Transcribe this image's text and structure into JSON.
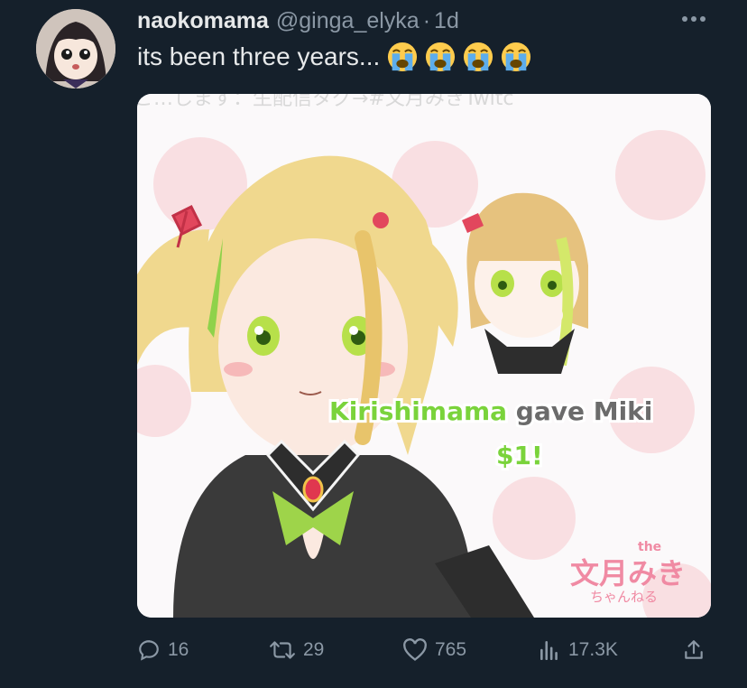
{
  "tweet": {
    "display_name": "naokomama",
    "handle": "@ginga_elyka",
    "separator": "·",
    "time": "1d",
    "text": "its been three years...",
    "emoji_icons": [
      "loudly-crying-face-icon",
      "loudly-crying-face-icon",
      "loudly-crying-face-icon",
      "loudly-crying-face-icon"
    ]
  },
  "media": {
    "top_caption": "ご…します：生配信タグ→#文月みきTwitc",
    "donation_name": "Kirishimama",
    "donation_text": " gave Miki",
    "donation_amount": "$1!",
    "logo_small": "the",
    "logo_main": "文月みき",
    "logo_sub": "ちゃんねる",
    "colors": {
      "donation_name": "#7ad33b",
      "logo": "#f08aa3"
    }
  },
  "actions": {
    "replies": "16",
    "retweets": "29",
    "likes": "765",
    "views": "17.3K"
  },
  "colors": {
    "background": "#15202b",
    "text": "#e7e9ea",
    "muted": "#8b98a5"
  }
}
